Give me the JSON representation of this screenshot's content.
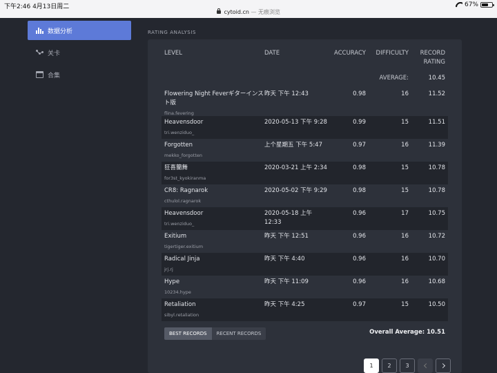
{
  "statusbar": {
    "time": "下午2:46   4月13日周二",
    "url": "cytoid.cn",
    "url_note": "— 无痕浏览",
    "battery": "67%",
    "battery_level": 0.67
  },
  "sidebar": {
    "items": [
      {
        "label": "数据分析",
        "icon": "bar-chart-icon",
        "active": true
      },
      {
        "label": "关卡",
        "icon": "nodes-icon",
        "active": false
      },
      {
        "label": "合集",
        "icon": "album-icon",
        "active": false
      }
    ]
  },
  "section_title": "RATING ANALYSIS",
  "table": {
    "headers": {
      "level": "LEVEL",
      "date": "DATE",
      "accuracy": "ACCURACY",
      "difficulty": "DIFFICULTY",
      "rating_line1": "RECORD",
      "rating_line2": "RATING"
    },
    "average_label": "AVERAGE:",
    "average_value": "10.45",
    "rows": [
      {
        "title": "Flowering Night Feverギターインスト版",
        "id": "flina.fevering",
        "date": "昨天 下午 12:43",
        "accuracy": "0.98",
        "difficulty": "16",
        "rating": "11.52"
      },
      {
        "title": "Heavensdoor",
        "id": "tri.wenziduo_",
        "date": "2020-05-13 下午 9:28",
        "accuracy": "0.99",
        "difficulty": "15",
        "rating": "11.51"
      },
      {
        "title": "Forgotten",
        "id": "mekko_forgotten",
        "date": "上个星期五 下午 5:47",
        "accuracy": "0.97",
        "difficulty": "16",
        "rating": "11.39"
      },
      {
        "title": "狂喜蘭舞",
        "id": "for3st_kyokiranma",
        "date": "2020-03-21 上午 2:34",
        "accuracy": "0.98",
        "difficulty": "15",
        "rating": "10.78"
      },
      {
        "title": "CR8: Ragnarok",
        "id": "cthulol.ragnarok",
        "date": "2020-05-02 下午 9:29",
        "accuracy": "0.98",
        "difficulty": "15",
        "rating": "10.78"
      },
      {
        "title": "Heavensdoor",
        "id": "tri.wenziduo_",
        "date": "2020-05-18 上午 12:33",
        "accuracy": "0.96",
        "difficulty": "17",
        "rating": "10.75"
      },
      {
        "title": "Exitium",
        "id": "tigertiger.exitium",
        "date": "昨天 下午 12:51",
        "accuracy": "0.96",
        "difficulty": "16",
        "rating": "10.72"
      },
      {
        "title": "Radical Jinja",
        "id": "jrj.rj",
        "date": "昨天 下午 4:40",
        "accuracy": "0.96",
        "difficulty": "16",
        "rating": "10.70"
      },
      {
        "title": "Hype",
        "id": "10234.hype",
        "date": "昨天 下午 11:09",
        "accuracy": "0.96",
        "difficulty": "16",
        "rating": "10.68"
      },
      {
        "title": "Retaliation",
        "id": "sibyl.retaliation",
        "date": "昨天 下午 4:25",
        "accuracy": "0.97",
        "difficulty": "15",
        "rating": "10.50"
      }
    ]
  },
  "tabs": {
    "best": "BEST RECORDS",
    "recent": "RECENT RECORDS"
  },
  "overall_average": "Overall Average: 10.51",
  "pagination": {
    "pages": [
      "1",
      "2",
      "3"
    ],
    "current": "1"
  },
  "colors": {
    "accent": "#5d7ad8",
    "background": "#24272f",
    "card": "#2d313a"
  }
}
